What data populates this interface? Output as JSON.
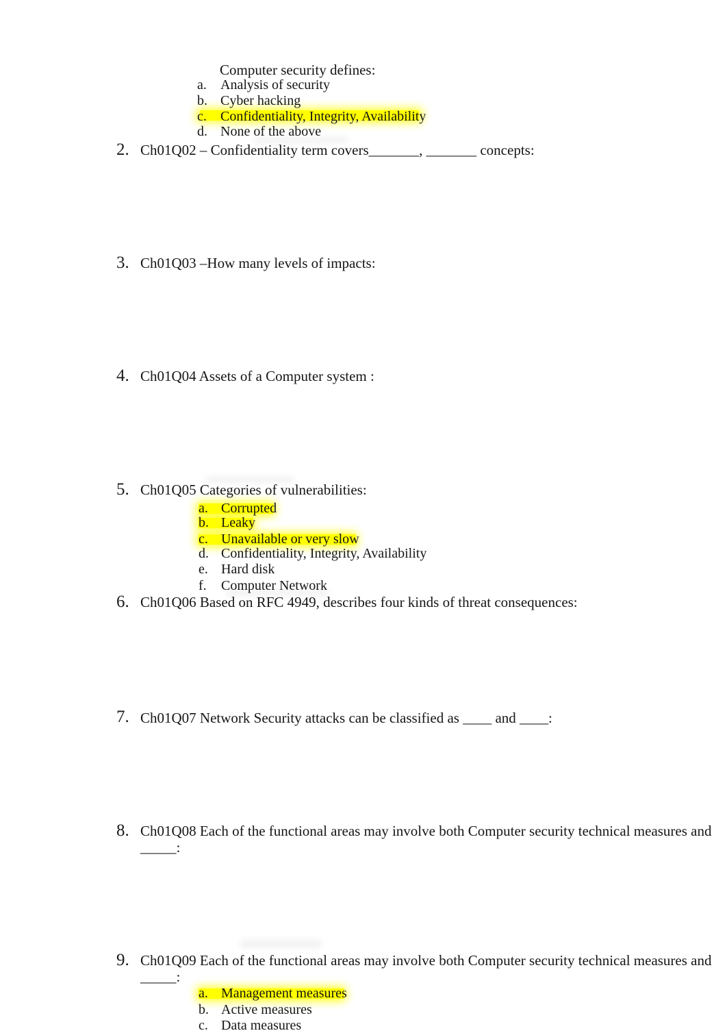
{
  "document": {
    "type": "quiz-worksheet",
    "highlight_color": "#ffff00",
    "page_background": "#ffffff",
    "text_color": "#151515"
  },
  "lead_question": {
    "prompt": "Computer security defines:",
    "options": [
      {
        "marker": "a.",
        "label": "Analysis of security",
        "highlighted": false
      },
      {
        "marker": "b.",
        "label": "Cyber hacking",
        "highlighted": false
      },
      {
        "marker": "c.",
        "label": "Confidentiality, Integrity, Availability",
        "highlighted": true
      },
      {
        "marker": "d.",
        "label": "None of the above",
        "highlighted": false
      }
    ]
  },
  "questions": [
    {
      "number": "2.",
      "text": "Ch01Q02 – Confidentiality term covers_______, _______ concepts:",
      "options": []
    },
    {
      "number": "3.",
      "text": "Ch01Q03 –How many levels of impacts:",
      "options": []
    },
    {
      "number": "4.",
      "text": "Ch01Q04 Assets of a Computer system :",
      "options": []
    },
    {
      "number": "5.",
      "text": "Ch01Q05 Categories of vulnerabilities:",
      "options": [
        {
          "marker": "a.",
          "label": "Corrupted",
          "highlighted": true
        },
        {
          "marker": "b.",
          "label": "Leaky",
          "highlighted": true
        },
        {
          "marker": "c.",
          "label": "Unavailable or very slow",
          "highlighted": true
        },
        {
          "marker": "d.",
          "label": "Confidentiality, Integrity, Availability",
          "highlighted": false
        },
        {
          "marker": "e.",
          "label": "Hard disk",
          "highlighted": false
        },
        {
          "marker": "f.",
          "label": "Computer Network",
          "highlighted": false
        }
      ]
    },
    {
      "number": "6.",
      "text": "Ch01Q06 Based on RFC 4949, describes four kinds of threat consequences:",
      "options": []
    },
    {
      "number": "7.",
      "text": "Ch01Q07 Network Security attacks can be classified as ____ and ____:",
      "options": []
    },
    {
      "number": "8.",
      "text": "Ch01Q08 Each of the functional areas may involve both Computer security technical measures and",
      "text_line2": "_____:",
      "options": []
    },
    {
      "number": "9.",
      "text": "Ch01Q09 Each of the functional areas may involve both Computer security technical measures and",
      "text_line2": "_____:",
      "options": [
        {
          "marker": "a.",
          "label": "Management measures",
          "highlighted": true
        },
        {
          "marker": "b.",
          "label": "Active measures",
          "highlighted": false
        },
        {
          "marker": "c.",
          "label": "Data measures",
          "highlighted": false
        }
      ]
    }
  ]
}
